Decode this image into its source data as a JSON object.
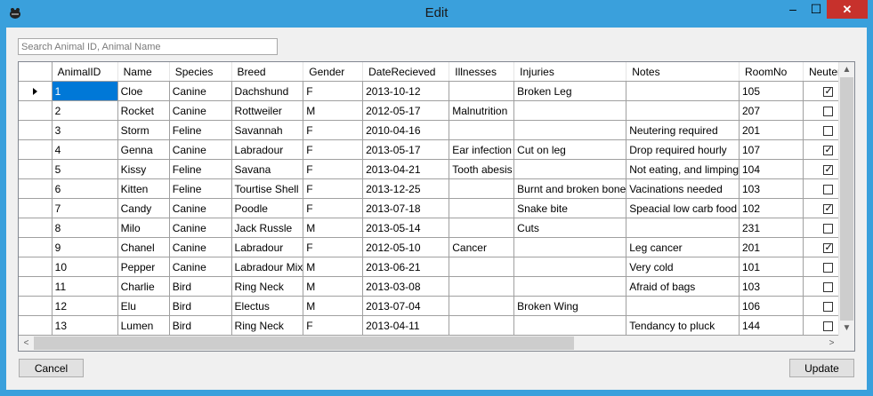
{
  "window": {
    "title": "Edit",
    "minimize_glyph": "–",
    "maximize_glyph": "☐",
    "close_glyph": "✕",
    "accent_color": "#3aa0dc",
    "close_color": "#c7312c"
  },
  "search": {
    "placeholder": "Search Animal ID, Animal Name",
    "value": ""
  },
  "grid": {
    "columns": [
      "AnimalID",
      "Name",
      "Species",
      "Breed",
      "Gender",
      "DateRecieved",
      "Illnesses",
      "Injuries",
      "Notes",
      "RoomNo",
      "Neutered"
    ],
    "selected_row": 0,
    "selection_color": "#0078d7",
    "rows": [
      {
        "id": "1",
        "name": "Cloe",
        "species": "Canine",
        "breed": "Dachshund",
        "gender": "F",
        "date": "2013-10-12",
        "illnesses": "",
        "injuries": "Broken Leg",
        "notes": "",
        "room": "105",
        "neutered": true
      },
      {
        "id": "2",
        "name": "Rocket",
        "species": "Canine",
        "breed": "Rottweiler",
        "gender": "M",
        "date": "2012-05-17",
        "illnesses": "Malnutrition",
        "injuries": "",
        "notes": "",
        "room": "207",
        "neutered": false
      },
      {
        "id": "3",
        "name": "Storm",
        "species": "Feline",
        "breed": "Savannah",
        "gender": "F",
        "date": "2010-04-16",
        "illnesses": "",
        "injuries": "",
        "notes": "Neutering required",
        "room": "201",
        "neutered": false
      },
      {
        "id": "4",
        "name": "Genna",
        "species": "Canine",
        "breed": "Labradour",
        "gender": "F",
        "date": "2013-05-17",
        "illnesses": "Ear infection",
        "injuries": "Cut on leg",
        "notes": "Drop required hourly",
        "room": "107",
        "neutered": true
      },
      {
        "id": "5",
        "name": "Kissy",
        "species": "Feline",
        "breed": "Savana",
        "gender": "F",
        "date": "2013-04-21",
        "illnesses": "Tooth abesis",
        "injuries": "",
        "notes": "Not eating, and limping",
        "room": "104",
        "neutered": true
      },
      {
        "id": "6",
        "name": "Kitten",
        "species": "Feline",
        "breed": "Tourtise Shell",
        "gender": "F",
        "date": "2013-12-25",
        "illnesses": "",
        "injuries": "Burnt and broken bone",
        "notes": "Vacinations needed",
        "room": "103",
        "neutered": false
      },
      {
        "id": "7",
        "name": "Candy",
        "species": "Canine",
        "breed": "Poodle",
        "gender": "F",
        "date": "2013-07-18",
        "illnesses": "",
        "injuries": "Snake bite",
        "notes": "Speacial low carb food",
        "room": "102",
        "neutered": true
      },
      {
        "id": "8",
        "name": "Milo",
        "species": "Canine",
        "breed": "Jack Russle",
        "gender": "M",
        "date": "2013-05-14",
        "illnesses": "",
        "injuries": "Cuts",
        "notes": "",
        "room": "231",
        "neutered": false
      },
      {
        "id": "9",
        "name": "Chanel",
        "species": "Canine",
        "breed": "Labradour",
        "gender": "F",
        "date": "2012-05-10",
        "illnesses": "Cancer",
        "injuries": "",
        "notes": "Leg cancer",
        "room": "201",
        "neutered": true
      },
      {
        "id": "10",
        "name": "Pepper",
        "species": "Canine",
        "breed": "Labradour Mix",
        "gender": "M",
        "date": "2013-06-21",
        "illnesses": "",
        "injuries": "",
        "notes": "Very cold",
        "room": "101",
        "neutered": false
      },
      {
        "id": "11",
        "name": "Charlie",
        "species": "Bird",
        "breed": "Ring Neck",
        "gender": "M",
        "date": "2013-03-08",
        "illnesses": "",
        "injuries": "",
        "notes": "Afraid of bags",
        "room": "103",
        "neutered": false
      },
      {
        "id": "12",
        "name": "Elu",
        "species": " Bird",
        "breed": "Electus",
        "gender": "M",
        "date": "2013-07-04",
        "illnesses": "",
        "injuries": "Broken Wing",
        "notes": "",
        "room": "106",
        "neutered": false
      },
      {
        "id": "13",
        "name": "Lumen",
        "species": "Bird",
        "breed": "Ring Neck",
        "gender": "F",
        "date": "2013-04-11",
        "illnesses": "",
        "injuries": "",
        "notes": "Tendancy to pluck",
        "room": "144",
        "neutered": false
      }
    ]
  },
  "scroll": {
    "up_glyph": "▲",
    "down_glyph": "▼",
    "left_glyph": "<",
    "right_glyph": ">"
  },
  "buttons": {
    "cancel_label": "Cancel",
    "update_label": "Update"
  }
}
